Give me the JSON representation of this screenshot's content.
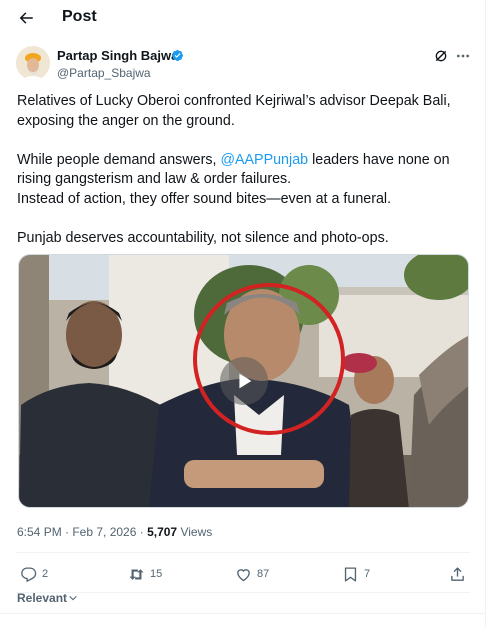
{
  "header": {
    "title": "Post",
    "back_icon": "arrow-left-icon"
  },
  "author": {
    "name": "Partap Singh Bajwa",
    "handle": "@Partap_Sbajwa",
    "verified_color": "#1d9bf0"
  },
  "tweet": {
    "line1": "Relatives of Lucky Oberoi confronted Kejriwal’s advisor Deepak Bali, exposing the anger on the ground.",
    "line2_prefix": "While people demand answers, ",
    "line2_mention": "@AAPPunjab",
    "line2_suffix": " leaders have none on rising gangsterism and law & order failures.",
    "line3": "Instead of action, they offer sound bites—even at a funeral.",
    "line4": "Punjab deserves accountability, not silence and photo-ops."
  },
  "meta": {
    "time": "6:54 PM · Feb 7, 2026 · ",
    "views_count": "5,707",
    "views_label": " Views"
  },
  "actions": {
    "replies": "2",
    "reposts": "15",
    "likes": "87",
    "bookmarks": "7"
  },
  "sort": {
    "label": "Relevant"
  },
  "colors": {
    "accent": "#1d9bf0",
    "secondary_text": "#536471",
    "highlight_circle": "#d32222"
  }
}
